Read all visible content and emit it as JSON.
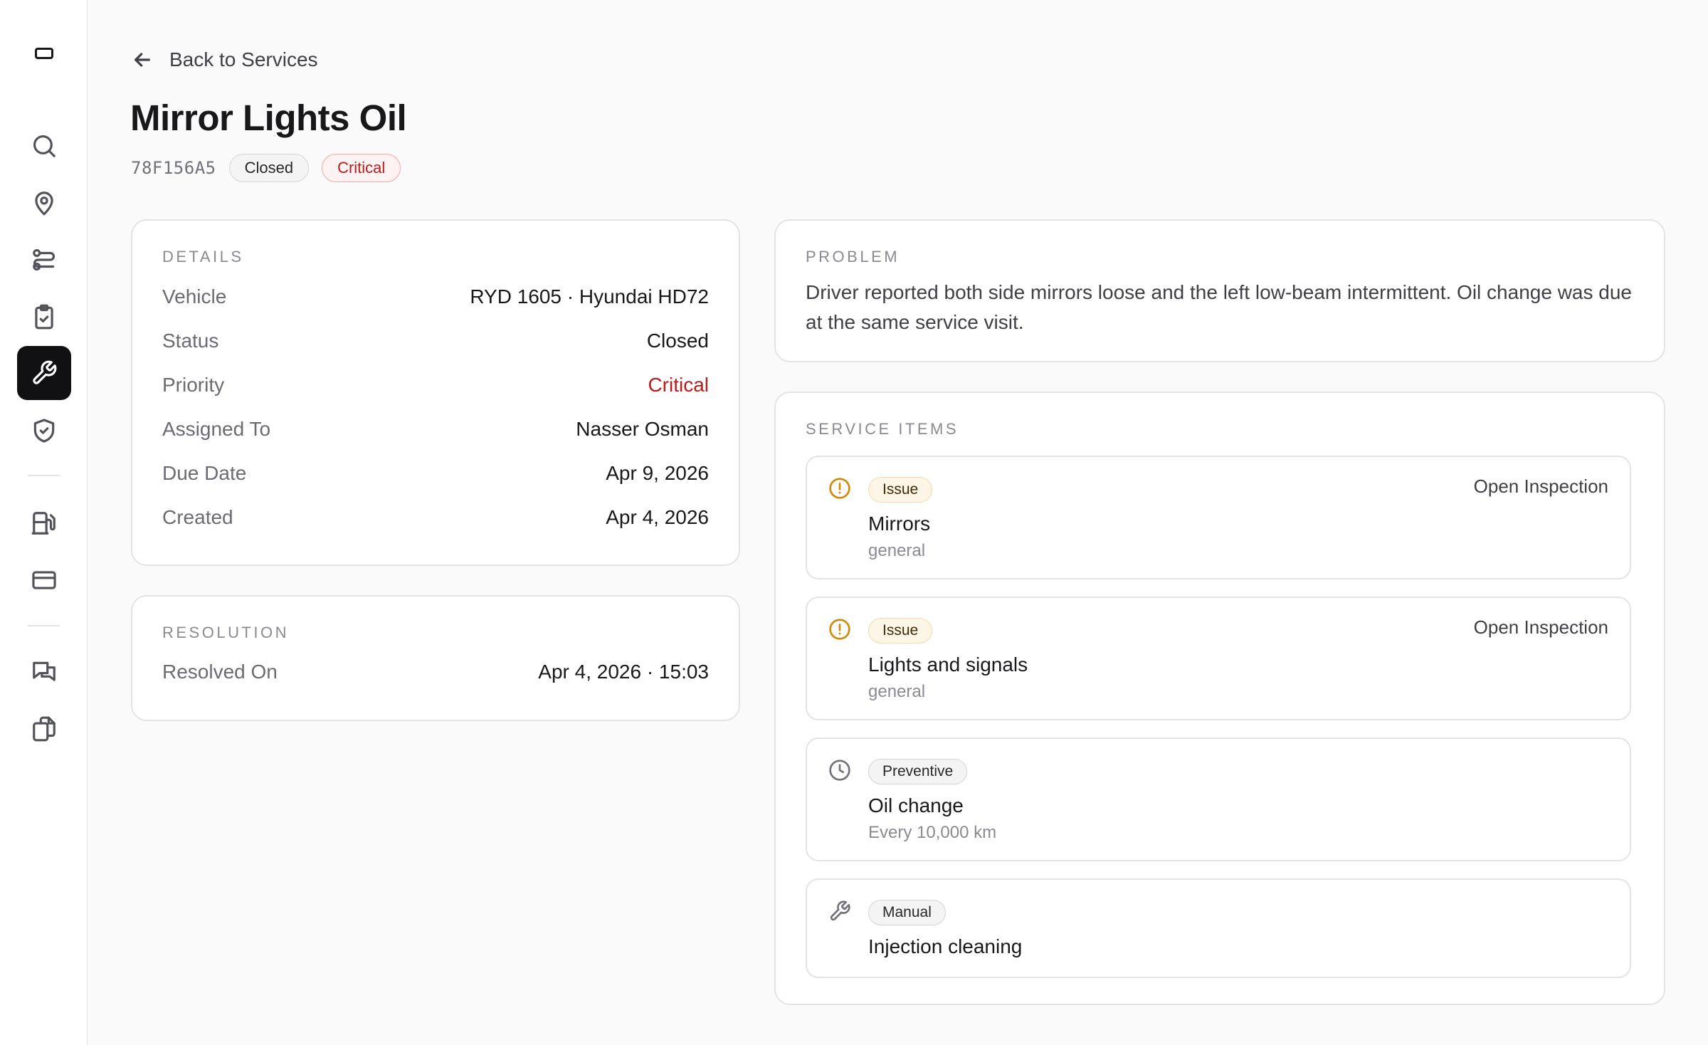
{
  "sidebar": {
    "logo_icon": "panel-icon",
    "items": [
      {
        "id": "search",
        "icon": "search-icon"
      },
      {
        "id": "locations",
        "icon": "map-pin-icon"
      },
      {
        "id": "routes",
        "icon": "route-icon"
      },
      {
        "id": "tasks",
        "icon": "clipboard-check-icon"
      },
      {
        "id": "services",
        "icon": "wrench-icon",
        "active": true
      },
      {
        "id": "compliance",
        "icon": "shield-check-icon"
      },
      {
        "id": "fuel",
        "icon": "fuel-icon"
      },
      {
        "id": "payments",
        "icon": "credit-card-icon"
      },
      {
        "id": "messages",
        "icon": "messages-icon"
      },
      {
        "id": "documents",
        "icon": "documents-icon"
      }
    ]
  },
  "back_label": "Back to Services",
  "header": {
    "title": "Mirror Lights Oil",
    "code": "78F156A5",
    "status_badge": "Closed",
    "priority_badge": "Critical"
  },
  "details": {
    "label": "DETAILS",
    "rows": [
      {
        "key": "Vehicle",
        "value": "RYD 1605 · Hyundai HD72"
      },
      {
        "key": "Status",
        "value": "Closed"
      },
      {
        "key": "Priority",
        "value": "Critical"
      },
      {
        "key": "Assigned To",
        "value": "Nasser Osman"
      },
      {
        "key": "Due Date",
        "value": "Apr 9, 2026"
      },
      {
        "key": "Created",
        "value": "Apr 4, 2026"
      }
    ]
  },
  "resolution": {
    "label": "RESOLUTION",
    "rows": [
      {
        "key": "Resolved On",
        "value": "Apr 4, 2026 · 15:03"
      }
    ]
  },
  "problem": {
    "label": "PROBLEM",
    "text": "Driver reported both side mirrors loose and the left low-beam intermittent. Oil change was due at the same service visit."
  },
  "service_items": {
    "label": "SERVICE ITEMS",
    "items": [
      {
        "type": "Issue",
        "icon": "alert-circle-icon",
        "name": "Mirrors",
        "sub": "general",
        "action": "Open Inspection"
      },
      {
        "type": "Issue",
        "icon": "alert-circle-icon",
        "name": "Lights and signals",
        "sub": "general",
        "action": "Open Inspection"
      },
      {
        "type": "Preventive",
        "icon": "clock-icon",
        "name": "Oil change",
        "sub": "Every 10,000 km"
      },
      {
        "type": "Manual",
        "icon": "wrench-icon",
        "name": "Injection cleaning"
      }
    ]
  },
  "colors": {
    "critical": "#b91c1c",
    "issue_icon": "#d08a0b",
    "active_nav": "#111113"
  }
}
